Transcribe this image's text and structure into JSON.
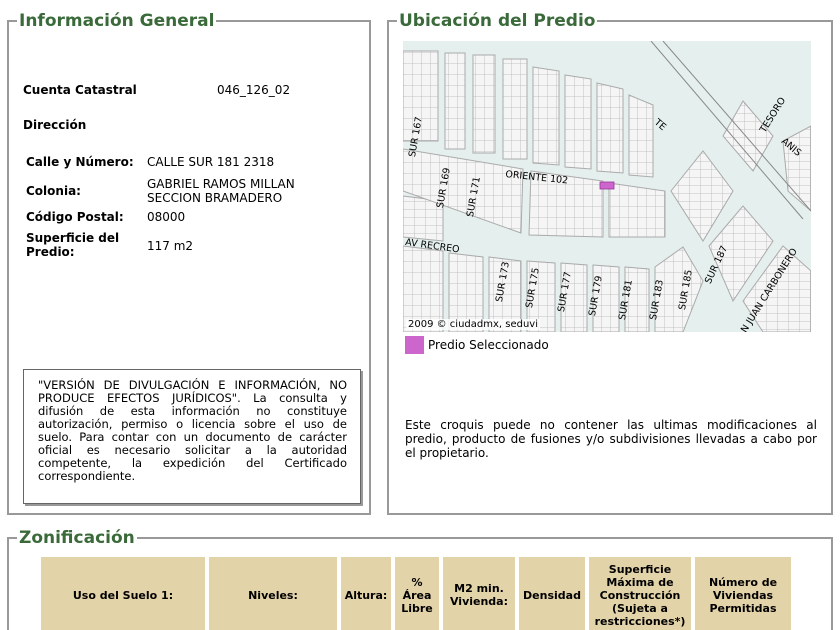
{
  "general": {
    "title": "Información General",
    "cuenta_label": "Cuenta Catastral",
    "cuenta_value": "046_126_02",
    "direccion_label": "Dirección",
    "calle_label": "Calle y Número:",
    "calle_value": "CALLE SUR 181 2318",
    "colonia_label": "Colonia:",
    "colonia_value_1": "GABRIEL RAMOS MILLAN",
    "colonia_value_2": "SECCION BRAMADERO",
    "cp_label": "Código Postal:",
    "cp_value": "08000",
    "superficie_label_1": "Superficie del",
    "superficie_label_2": "Predio:",
    "superficie_value": "117 m2",
    "disclaimer": "\"VERSIÓN DE DIVULGACIÓN E INFORMACIÓN, NO PRODUCE EFECTOS JURÍDICOS\". La consulta y difusión de esta información no constituye autorización, permiso o licencia sobre el uso de suelo. Para contar con un documento de carácter oficial es necesario solicitar a la autoridad competente, la expedición del Certificado correspondiente."
  },
  "ubicacion": {
    "title": "Ubicación del Predio",
    "map_credit": "2009 © ciudadmx, seduvi",
    "legend_label": "Predio Seleccionado",
    "legend_color": "#cc66cc",
    "note": "Este croquis puede no contener las ultimas modificaciones al predio, producto de fusiones y/o subdivisiones llevadas a cabo por el propietario.",
    "streets": {
      "sur167": "SUR 167",
      "sur169": "SUR 169",
      "sur171": "SUR 171",
      "oriente102": "ORIENTE 102",
      "av_recreo": "AV RECREO",
      "sur173": "SUR 173",
      "sur175": "SUR 175",
      "sur177": "SUR 177",
      "sur179": "SUR 179",
      "sur181": "SUR 181",
      "sur183": "SUR 183",
      "sur185": "SUR 185",
      "sur187": "SUR 187",
      "juan_carbonero": "N JUAN CARBONERO",
      "tesoro": "TESORO",
      "te": "TE",
      "anis": "ANIS"
    }
  },
  "zonificacion": {
    "title": "Zonificación",
    "headers": [
      "Uso del Suelo 1:",
      "Niveles:",
      "Altura:",
      "% Área Libre",
      "M2 min. Vivienda:",
      "Densidad",
      "Superficie Máxima de Construcción (Sujeta a restricciones*)",
      "Número de Viviendas Permitidas"
    ],
    "header_color": "#e3d3a8"
  }
}
